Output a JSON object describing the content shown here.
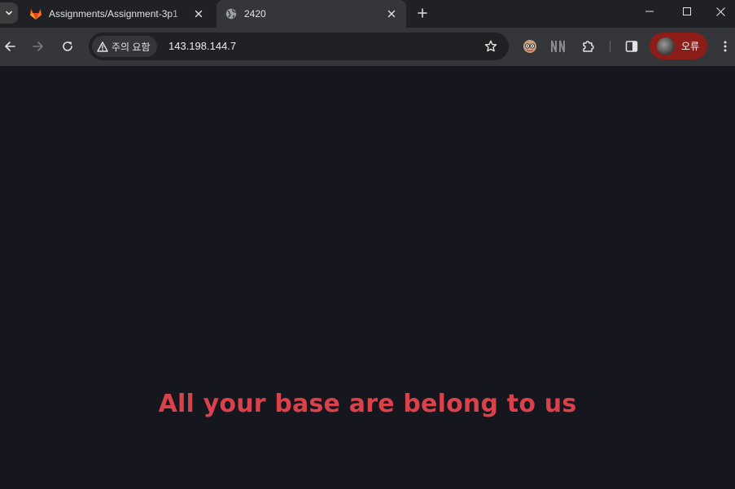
{
  "tabs": [
    {
      "title": "Assignments/Assignment-3p1",
      "icon": "gitlab-icon",
      "active": false
    },
    {
      "title": "2420",
      "icon": "globe-icon",
      "active": true
    }
  ],
  "toolbar": {
    "security_label": "주의 요함",
    "url": "143.198.144.7",
    "profile_label": "오류"
  },
  "page": {
    "headline": "All your base are belong to us"
  },
  "colors": {
    "page_background": "#16161e",
    "headline": "#d9414b",
    "profile_chip": "#8c1d18",
    "gitlab_orange": "#e24329"
  }
}
